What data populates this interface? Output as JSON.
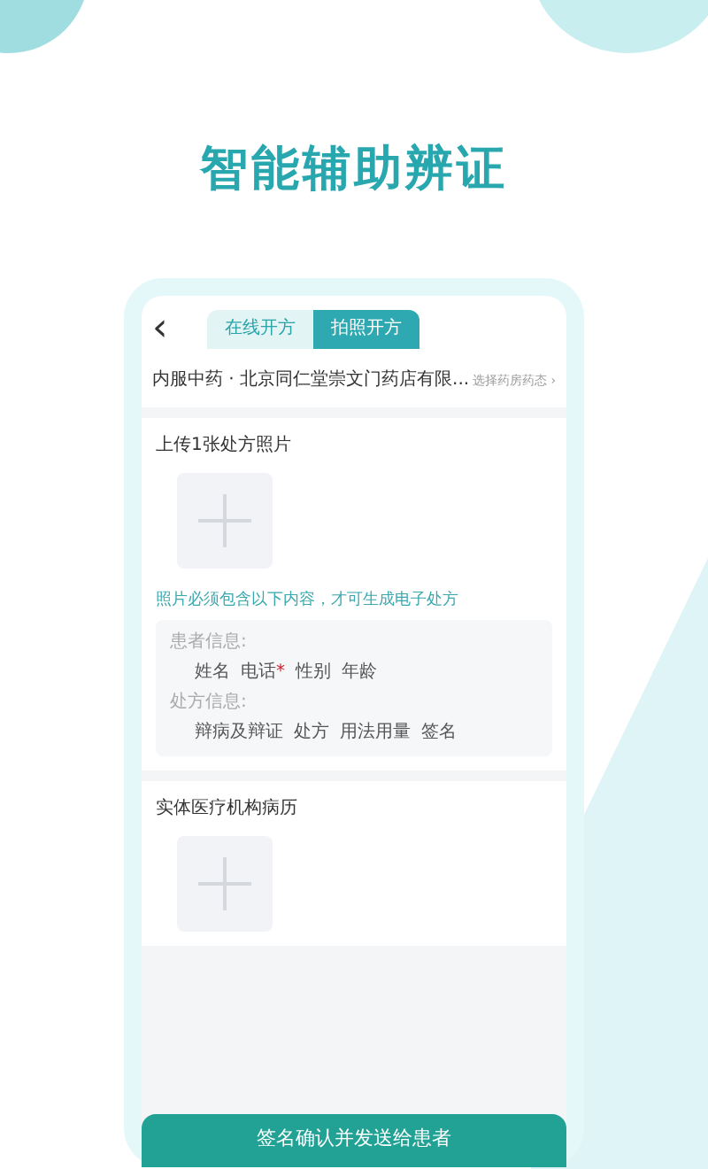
{
  "headline": "智能辅助辨证",
  "tabs": [
    {
      "label": "在线开方",
      "selected": false
    },
    {
      "label": "拍照开方",
      "selected": true
    }
  ],
  "back": "‹",
  "store": {
    "text": "内服中药 · 北京同仁堂崇文门药店有限...",
    "action": "选择药房药态",
    "chevron": "›"
  },
  "upload": {
    "title": "上传1张处方照片",
    "hint": "照片必须包含以下内容，才可生成电子处方",
    "groups": [
      {
        "label": "患者信息:",
        "items": [
          {
            "text": "姓名"
          },
          {
            "text": "电话",
            "mark": "*"
          },
          {
            "text": "性别"
          },
          {
            "text": "年龄"
          }
        ]
      },
      {
        "label": "处方信息:",
        "items": [
          {
            "text": "辩病及辩证"
          },
          {
            "text": "处方"
          },
          {
            "text": "用法用量"
          },
          {
            "text": "签名"
          }
        ]
      }
    ]
  },
  "record": {
    "title": "实体医疗机构病历"
  },
  "submit": "签名确认并发送给患者"
}
